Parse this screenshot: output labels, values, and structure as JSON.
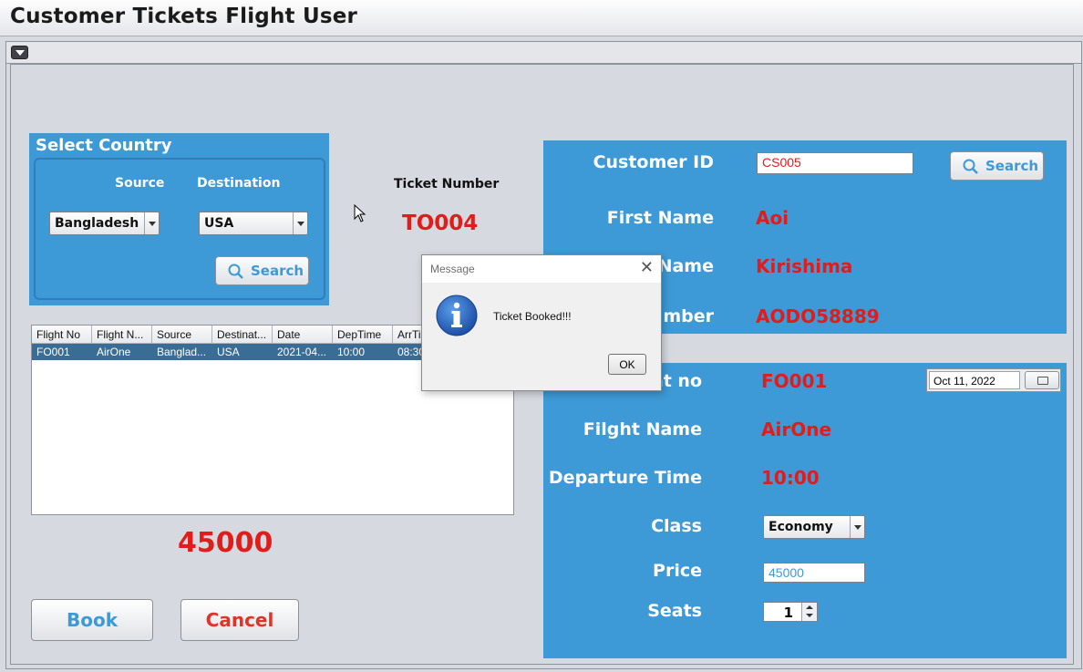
{
  "window": {
    "title": "Customer Tickets Flight User"
  },
  "select_country": {
    "heading": "Select Country",
    "source_label": "Source",
    "destination_label": "Destination",
    "source_value": "Bangladesh",
    "destination_value": "USA",
    "search_label": "Search"
  },
  "ticket": {
    "label": "Ticket Number",
    "value": "TO004"
  },
  "flights_table": {
    "columns": [
      "Flight No",
      "Flight N...",
      "Source",
      "Destinat...",
      "Date",
      "DepTime",
      "ArrTi"
    ],
    "rows": [
      [
        "FO001",
        "AirOne",
        "Banglad...",
        "USA",
        "2021-04...",
        "10:00",
        "08:30"
      ]
    ]
  },
  "price_total": "45000",
  "actions": {
    "book_label": "Book",
    "cancel_label": "Cancel"
  },
  "customer": {
    "id_label": "Customer ID",
    "id_value": "CS005",
    "search_label": "Search",
    "first_name_label": "First Name",
    "first_name_value": "Aoi",
    "last_name_label": "Name",
    "last_name_value": "Kirishima",
    "passport_label": "umber",
    "passport_value": "AODO58889"
  },
  "flight": {
    "flight_no_label": "nt no",
    "flight_no_value": "FO001",
    "date_value": "Oct 11, 2022",
    "flight_name_label": "Filght Name",
    "flight_name_value": "AirOne",
    "departure_label": "Departure Time",
    "departure_value": "10:00",
    "class_label": "Class",
    "class_value": "Economy",
    "price_label": "Price",
    "price_value": "45000",
    "seats_label": "Seats",
    "seats_value": "1"
  },
  "dialog": {
    "title": "Message",
    "message": "Ticket Booked!!!",
    "ok_label": "OK",
    "close_glyph": "✕"
  },
  "colors": {
    "panel_blue": "#3d9ad6",
    "value_red": "#e21b1b",
    "selected_row": "#3a6d96"
  }
}
